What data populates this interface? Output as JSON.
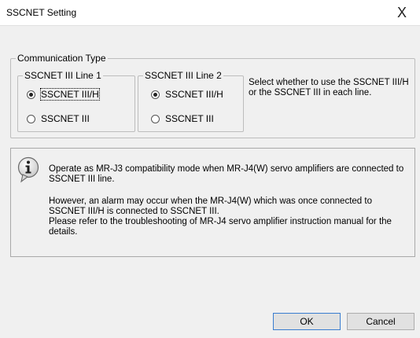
{
  "window": {
    "title": "SSCNET Setting",
    "close_label": "X"
  },
  "communication_type": {
    "label": "Communication Type",
    "line1": {
      "label": "SSCNET III Line 1",
      "options": [
        "SSCNET III/H",
        "SSCNET III"
      ],
      "selected": "SSCNET III/H"
    },
    "line2": {
      "label": "SSCNET III Line 2",
      "options": [
        "SSCNET III/H",
        "SSCNET III"
      ],
      "selected": "SSCNET III/H"
    },
    "description": "Select whether to use the SSCNET III/H or the SSCNET III in each line."
  },
  "info": {
    "icon": "info-icon",
    "line1": "Operate as MR-J3 compatibility mode when MR-J4(W) servo amplifiers are connected to SSCNET III line.",
    "line2": "However, an alarm may occur when the MR-J4(W) which was once connected to SSCNET III/H is connected to SSCNET III.",
    "line3": "Please refer to the troubleshooting of MR-J4 servo amplifier instruction manual for the details."
  },
  "buttons": {
    "ok": "OK",
    "cancel": "Cancel"
  }
}
